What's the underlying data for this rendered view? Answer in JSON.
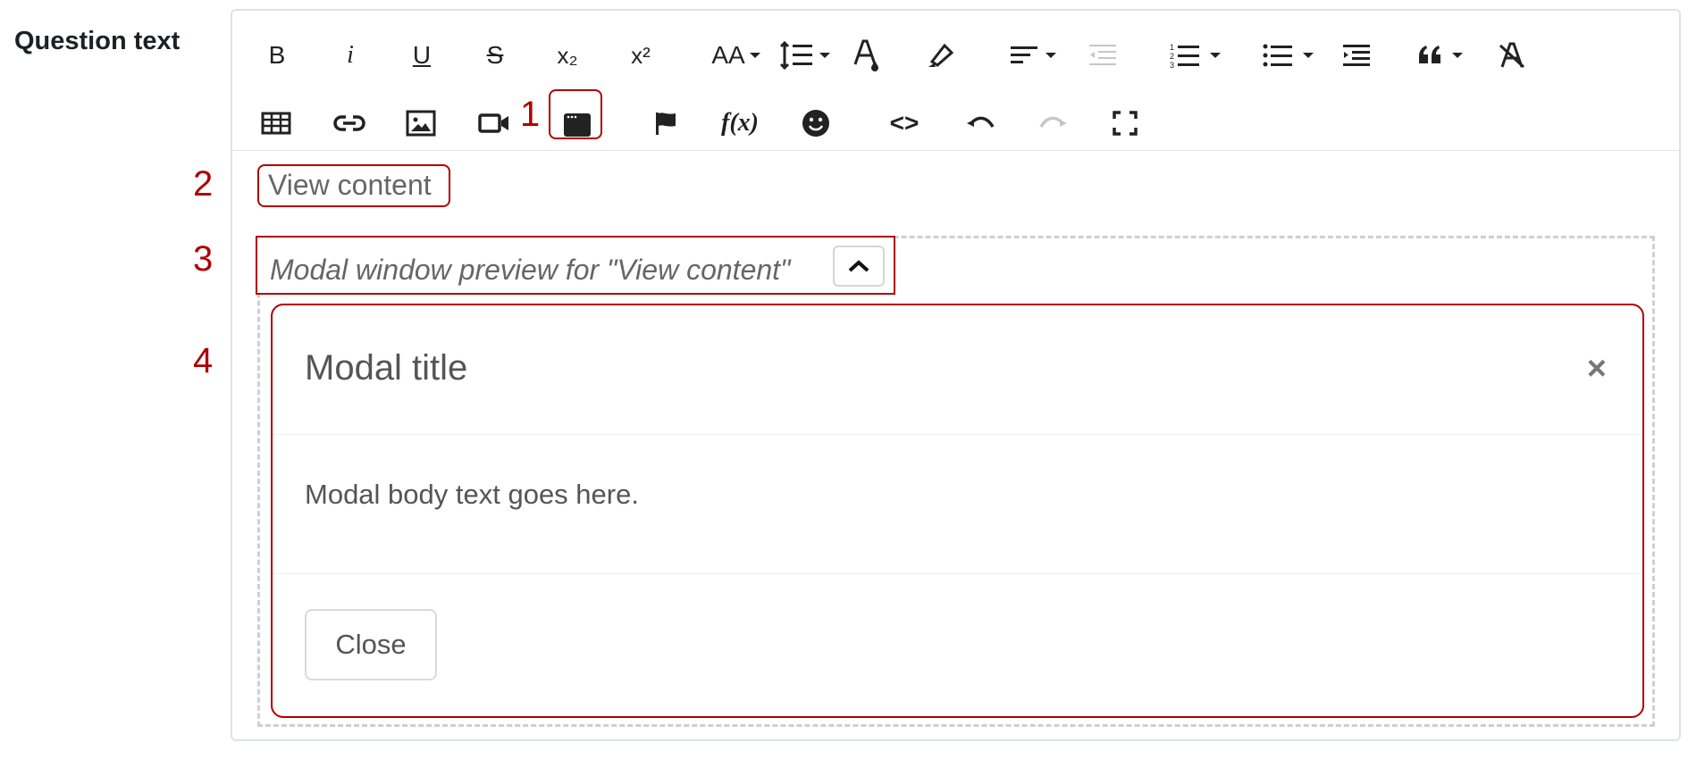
{
  "field": {
    "label": "Question text"
  },
  "toolbar": {
    "row1": [
      {
        "name": "bold-icon",
        "glyph": "B"
      },
      {
        "name": "italic-icon",
        "glyph": "i"
      },
      {
        "name": "underline-icon",
        "glyph": "U"
      },
      {
        "name": "strikethrough-icon",
        "glyph": "S"
      },
      {
        "name": "subscript-icon",
        "glyph": "x₂"
      },
      {
        "name": "superscript-icon",
        "glyph": "x²"
      },
      {
        "name": "font-size-icon",
        "glyph": "AA"
      },
      {
        "name": "line-height-icon",
        "glyph": ""
      },
      {
        "name": "text-color-icon",
        "glyph": "A"
      },
      {
        "name": "highlight-icon",
        "glyph": ""
      },
      {
        "name": "align-icon",
        "glyph": ""
      },
      {
        "name": "outdent-icon",
        "glyph": ""
      },
      {
        "name": "ordered-list-icon",
        "glyph": ""
      },
      {
        "name": "bullet-list-icon",
        "glyph": ""
      },
      {
        "name": "indent-icon",
        "glyph": ""
      },
      {
        "name": "blockquote-icon",
        "glyph": "66"
      },
      {
        "name": "clear-formatting-icon",
        "glyph": "A"
      }
    ],
    "row2": [
      {
        "name": "table-icon"
      },
      {
        "name": "link-icon"
      },
      {
        "name": "image-icon"
      },
      {
        "name": "video-icon"
      },
      {
        "name": "modal-window-icon"
      },
      {
        "name": "flag-icon"
      },
      {
        "name": "formula-icon",
        "glyph": "f(x)"
      },
      {
        "name": "emoji-icon"
      },
      {
        "name": "source-code-icon",
        "glyph": "<>"
      },
      {
        "name": "undo-icon"
      },
      {
        "name": "redo-icon"
      },
      {
        "name": "fullscreen-icon"
      }
    ]
  },
  "annotations": [
    "1",
    "2",
    "3",
    "4"
  ],
  "content": {
    "view_content": "View content",
    "preview_label": "Modal window preview for \"View content\""
  },
  "modal": {
    "title": "Modal title",
    "close_x": "×",
    "body": "Modal body text goes here.",
    "close_label": "Close"
  },
  "colors": {
    "annotation": "#b00000",
    "border": "#dee2e6",
    "text": "#555555"
  }
}
